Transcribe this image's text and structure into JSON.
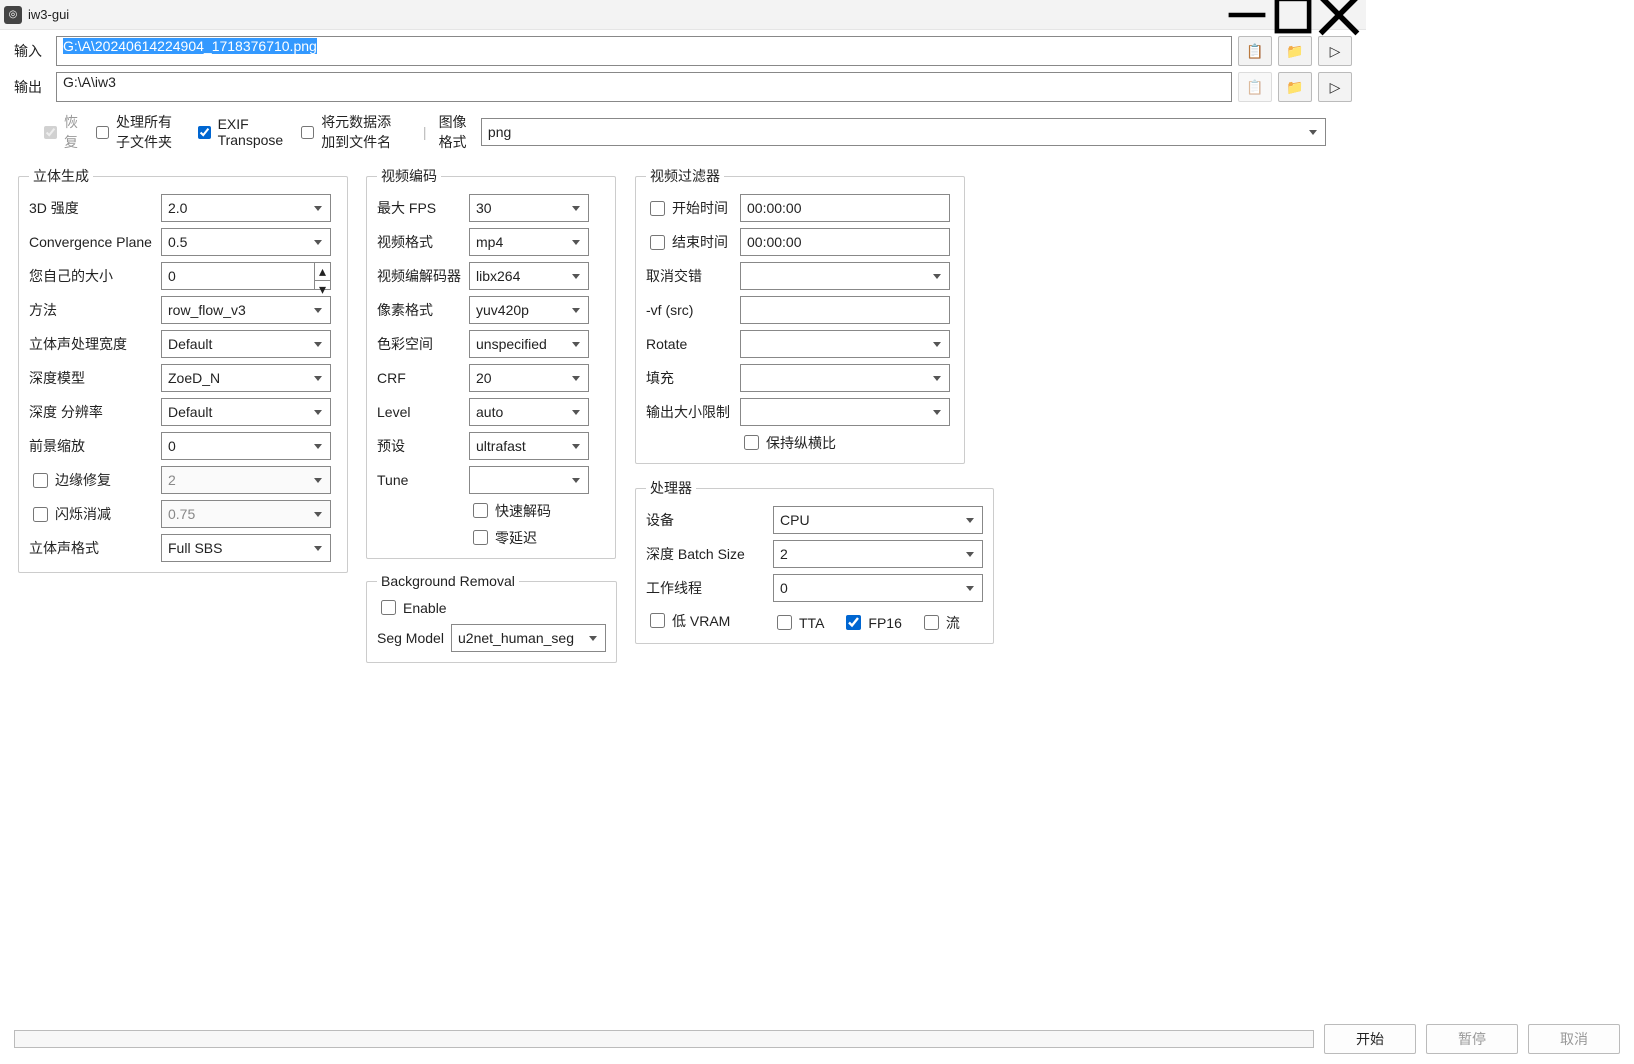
{
  "window": {
    "title": "iw3-gui"
  },
  "io": {
    "input_label": "输入",
    "output_label": "输出",
    "input_path": "G:\\A\\20240614224904_1718376710.png",
    "input_selected": true,
    "output_path": "G:\\A\\iw3"
  },
  "opts": {
    "resume": {
      "label": "恢复",
      "checked": true,
      "disabled": true
    },
    "recursive": {
      "label": "处理所有子文件夹",
      "checked": false
    },
    "exif": {
      "label": "EXIF Transpose",
      "checked": true
    },
    "meta_fn": {
      "label": "将元数据添加到文件名",
      "checked": false
    },
    "img_format_label": "图像格式",
    "img_format": "png"
  },
  "stereo": {
    "legend": "立体生成",
    "strength_label": "3D 强度",
    "strength": "2.0",
    "converge_label": "Convergence Plane",
    "converge": "0.5",
    "own_size_label": "您自己的大小",
    "own_size": "0",
    "method_label": "方法",
    "method": "row_flow_v3",
    "proc_width_label": "立体声处理宽度",
    "proc_width": "Default",
    "depth_model_label": "深度模型",
    "depth_model": "ZoeD_N",
    "depth_res_label": "深度 分辨率",
    "depth_res": "Default",
    "fg_scale_label": "前景缩放",
    "fg_scale": "0",
    "edge_fix_label": "边缘修复",
    "edge_fix_val": "2",
    "flicker_label": "闪烁消减",
    "flicker_val": "0.75",
    "format_label": "立体声格式",
    "format": "Full SBS"
  },
  "venc": {
    "legend": "视频编码",
    "maxfps_label": "最大 FPS",
    "maxfps": "30",
    "vformat_label": "视频格式",
    "vformat": "mp4",
    "codec_label": "视频编解码器",
    "codec": "libx264",
    "pixfmt_label": "像素格式",
    "pixfmt": "yuv420p",
    "colorspace_label": "色彩空间",
    "colorspace": "unspecified",
    "crf_label": "CRF",
    "crf": "20",
    "level_label": "Level",
    "level": "auto",
    "preset_label": "预设",
    "preset": "ultrafast",
    "tune_label": "Tune",
    "tune": "",
    "fastdecode_label": "快速解码",
    "zerolat_label": "零延迟"
  },
  "bgr": {
    "legend": "Background Removal",
    "enable_label": "Enable",
    "seg_label": "Seg Model",
    "seg_model": "u2net_human_seg"
  },
  "vfilter": {
    "legend": "视频过滤器",
    "start_label": "开始时间",
    "start": "00:00:00",
    "end_label": "结束时间",
    "end": "00:00:00",
    "deint_label": "取消交错",
    "deint": "",
    "vf_label": "-vf (src)",
    "vf": "",
    "rotate_label": "Rotate",
    "rotate": "",
    "pad_label": "填充",
    "pad": "",
    "outlimit_label": "输出大小限制",
    "outlimit": "",
    "keepaspect_label": "保持纵横比"
  },
  "proc": {
    "legend": "处理器",
    "device_label": "设备",
    "device": "CPU",
    "batch_label": "深度 Batch Size",
    "batch": "2",
    "workers_label": "工作线程",
    "workers": "0",
    "lowvram_label": "低 VRAM",
    "tta_label": "TTA",
    "fp16_label": "FP16",
    "fp16_checked": true,
    "stream_label": "流"
  },
  "footer": {
    "start": "开始",
    "pause": "暂停",
    "cancel": "取消"
  }
}
